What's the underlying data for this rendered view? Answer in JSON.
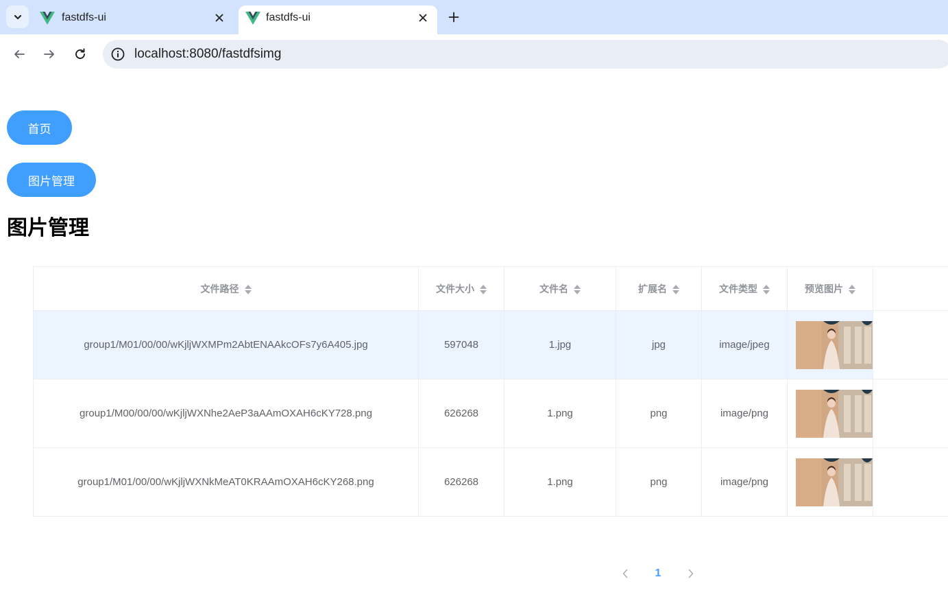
{
  "browser": {
    "tabs": [
      {
        "title": "fastdfs-ui",
        "active": false,
        "icon": "vue-logo-icon"
      },
      {
        "title": "fastdfs-ui",
        "active": true,
        "icon": "vue-logo-icon"
      }
    ],
    "url": "localhost:8080/fastdfsimg"
  },
  "nav": {
    "home_label": "首页",
    "images_label": "图片管理"
  },
  "page": {
    "title": "图片管理"
  },
  "table": {
    "columns": [
      "文件路径",
      "文件大小",
      "文件名",
      "扩展名",
      "文件类型",
      "预览图片"
    ],
    "rows": [
      {
        "path": "group1/M01/00/00/wKjljWXMPm2AbtENAAkcOFs7y6A405.jpg",
        "size": "597048",
        "name": "1.jpg",
        "ext": "jpg",
        "type": "image/jpeg",
        "highlighted": true
      },
      {
        "path": "group1/M00/00/00/wKjljWXNhe2AeP3aAAmOXAH6cKY728.png",
        "size": "626268",
        "name": "1.png",
        "ext": "png",
        "type": "image/png",
        "highlighted": false
      },
      {
        "path": "group1/M01/00/00/wKjljWXNkMeAT0KRAAmOXAH6cKY268.png",
        "size": "626268",
        "name": "1.png",
        "ext": "png",
        "type": "image/png",
        "highlighted": false
      }
    ]
  },
  "pagination": {
    "current_page": "1"
  },
  "colors": {
    "primary": "#409eff",
    "row_highlight": "#ecf5ff",
    "tabstrip": "#d3e3fd"
  }
}
